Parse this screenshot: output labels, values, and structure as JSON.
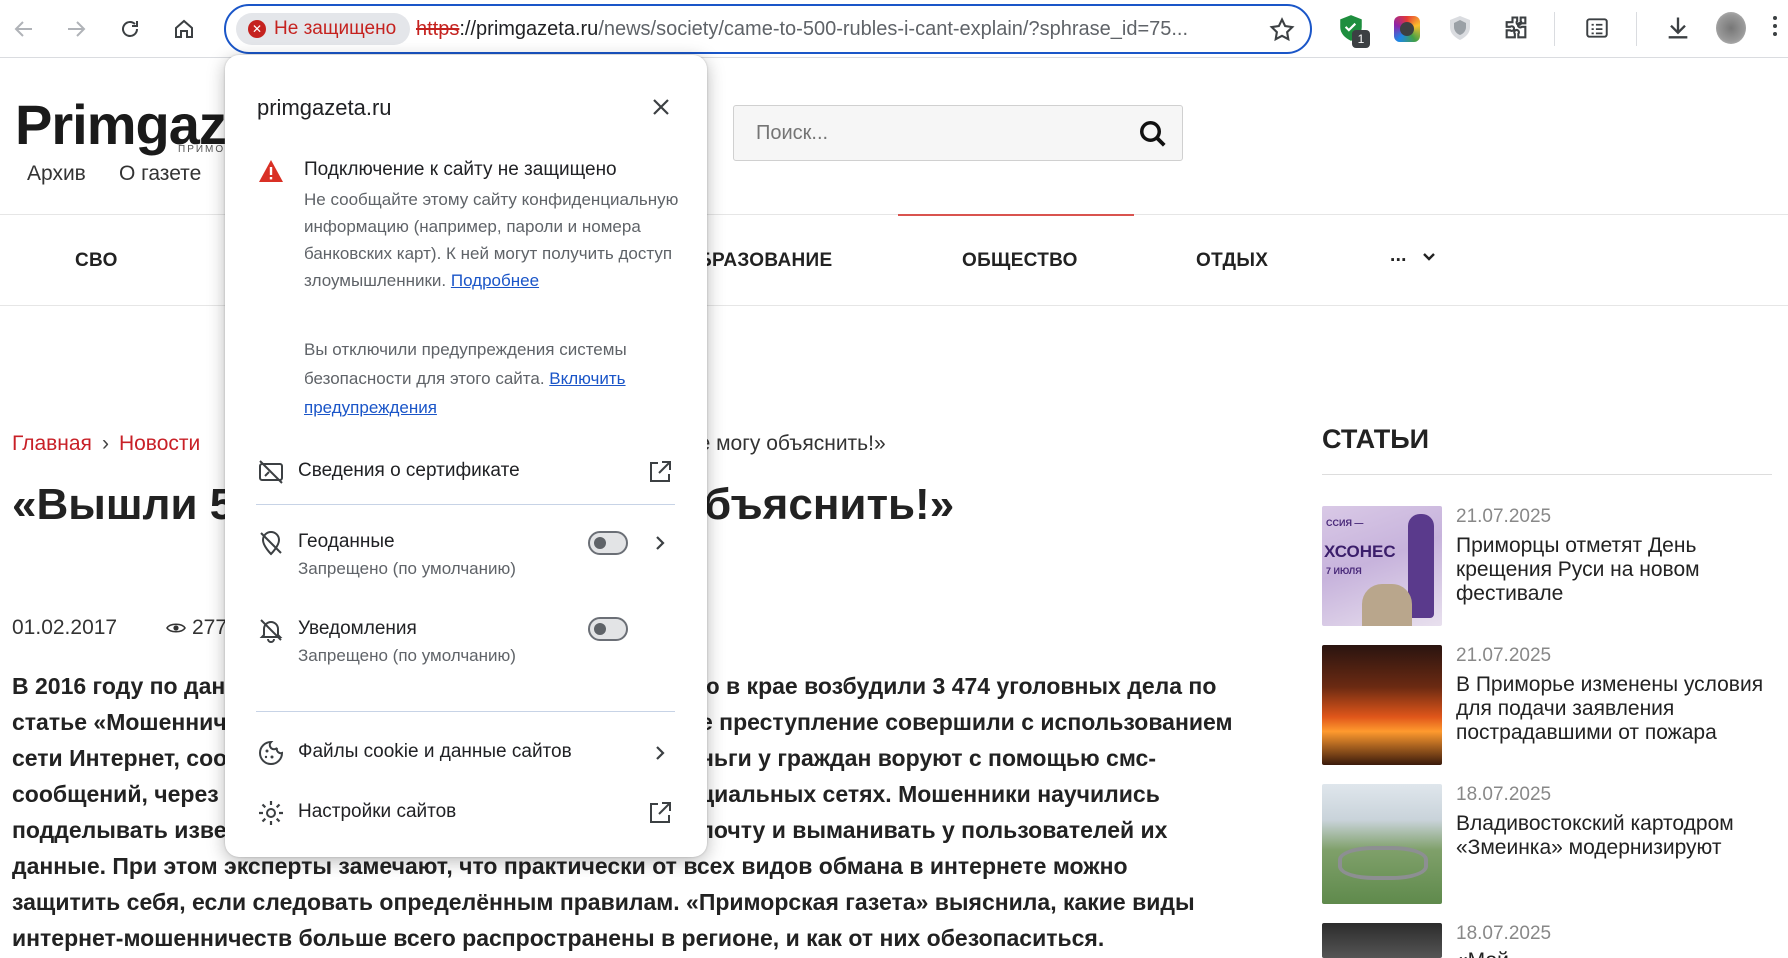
{
  "browser": {
    "security_chip": "Не защищено",
    "url_scheme": "https",
    "url_host": "://primgazeta.ru",
    "url_path": "/news/society/came-to-500-rubles-i-cant-explain/?sphrase_id=75...",
    "extension_badge": "1"
  },
  "site": {
    "logo": "Primgaz",
    "logo_sub": "ПРИМОР",
    "nav_archive": "Архив",
    "nav_about": "О газете",
    "search_placeholder": "Поиск...",
    "categories": {
      "svo": "СВО",
      "education": "ОБРАЗОВАНИЕ",
      "society": "ОБЩЕСТВО",
      "leisure": "ОТДЫХ",
      "more": "..."
    }
  },
  "article": {
    "breadcrumb_home": "Главная",
    "breadcrumb_news": "Новости",
    "breadcrumb_current": "не могу объяснить!»",
    "headline_left": "«Вышли 5",
    "headline_right": "бъяснить!»",
    "date": "01.02.2017",
    "views": "277",
    "body": [
      {
        "left": "В 2016 году по дан",
        "right": "ю в крае возбудили 3 474 уголовных дела по"
      },
      {
        "left": "статье «Мошеннич",
        "right": "е преступление совершили с использованием"
      },
      {
        "left": "сети Интернет, соо",
        "right": "ньги у граждан воруют с помощью смс-"
      },
      {
        "left": "сообщений, через",
        "right": "циальных сетях. Мошенники научились"
      },
      {
        "left": "подделывать изве",
        "right": "почту и выманивать у пользователей их"
      },
      {
        "left": "данные. При этом эксперты замечают, что практически от всех видов обмана в интернете можно",
        "right": ""
      },
      {
        "left": "защитить себя, если следовать определённым правилам. «Приморская газета» выяснила, какие виды",
        "right": ""
      },
      {
        "left": "интернет-мошенничеств больше всего распространены в регионе, и как от них обезопаситься.",
        "right": ""
      }
    ]
  },
  "sidebar": {
    "title": "СТАТЬИ",
    "items": [
      {
        "date": "21.07.2025",
        "title": "Приморцы отметят День крещения Руси на новом фестивале",
        "thumb_lines": [
          "ССИЯ —",
          "ХСОНЕС",
          "7 ИЮЛЯ"
        ]
      },
      {
        "date": "21.07.2025",
        "title": "В Приморье изменены условия для подачи заявления пострадавшими от пожара"
      },
      {
        "date": "18.07.2025",
        "title": "Владивостокский картодром «Змеинка» модернизируют"
      },
      {
        "date": "18.07.2025",
        "title": "«Мой"
      }
    ]
  },
  "popup": {
    "domain": "primgazeta.ru",
    "warning_title": "Подключение к сайту не защищено",
    "warning_text": "Не сообщайте этому сайту конфиденциальную информацию (например, пароли и номера банковских карт). К ней могут получить доступ злоумышленники.",
    "learn_more": "Подробнее",
    "disabled_text": "Вы отключили предупреждения системы безопасности для этого сайта.",
    "enable_link": "Включить предупреждения",
    "certificate": "Сведения о сертификате",
    "geo_label": "Геоданные",
    "geo_sub": "Запрещено (по умолчанию)",
    "notif_label": "Уведомления",
    "notif_sub": "Запрещено (по умолчанию)",
    "cookies": "Файлы cookie и данные сайтов",
    "site_settings": "Настройки сайтов"
  },
  "colors": {
    "accent_red": "#c82027",
    "omnibox_border": "#1a56c8",
    "link_blue": "#1a55c8"
  }
}
